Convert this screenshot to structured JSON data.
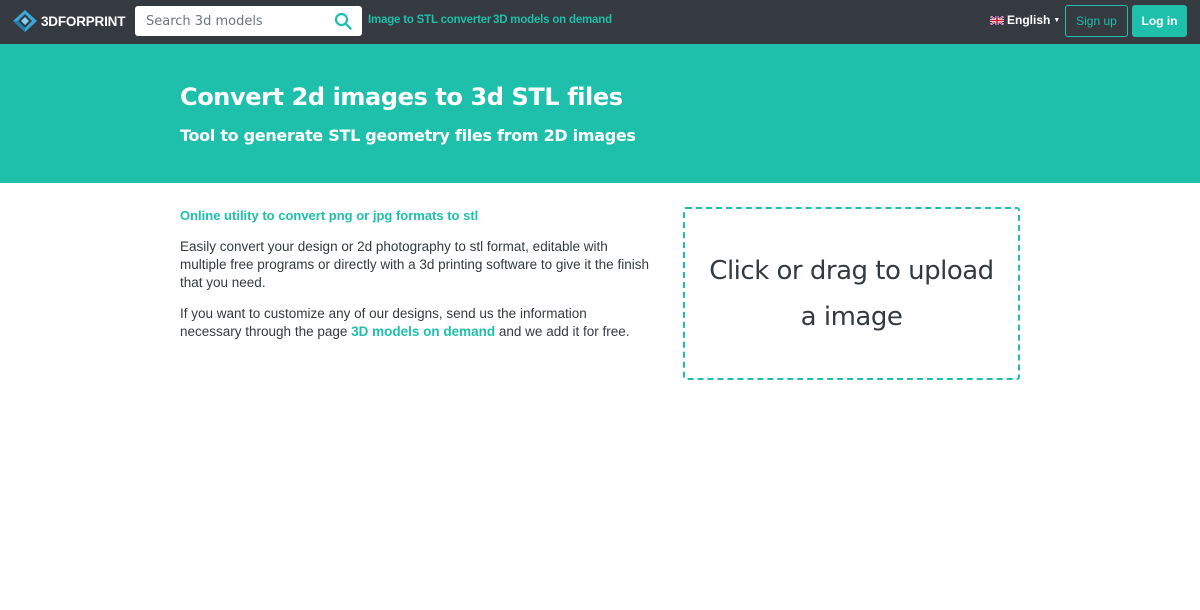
{
  "colors": {
    "navbar": "#343a40",
    "accent": "#1ebfab",
    "text": "#343a40"
  },
  "navbar": {
    "brand": "3DFORPRINT",
    "brand_logo_icon": "3dforprint-logo-icon",
    "search": {
      "placeholder": "Search 3d models",
      "value": "",
      "icon": "search-icon"
    },
    "links": [
      {
        "label": "Image to STL converter"
      },
      {
        "label": "3D models on demand"
      }
    ],
    "language": {
      "label": "English",
      "flag_icon": "uk-flag-icon"
    },
    "signup_label": "Sign up",
    "login_label": "Log in"
  },
  "hero": {
    "title": "Convert 2d images to 3d STL files",
    "subtitle": "Tool to generate STL geometry files from 2D images"
  },
  "content": {
    "heading": "Online utility to convert png or jpg formats to stl",
    "paragraph1": "Easily convert your design or 2d photography to stl format, editable with multiple free programs or directly with a 3d printing software to give it the finish that you need.",
    "paragraph2_before": "If you want to customize any of our designs, send us the information necessary through the page ",
    "paragraph2_link": "3D models on demand",
    "paragraph2_after": " and we add it for free."
  },
  "upload": {
    "label": "Click or drag to upload a image"
  }
}
